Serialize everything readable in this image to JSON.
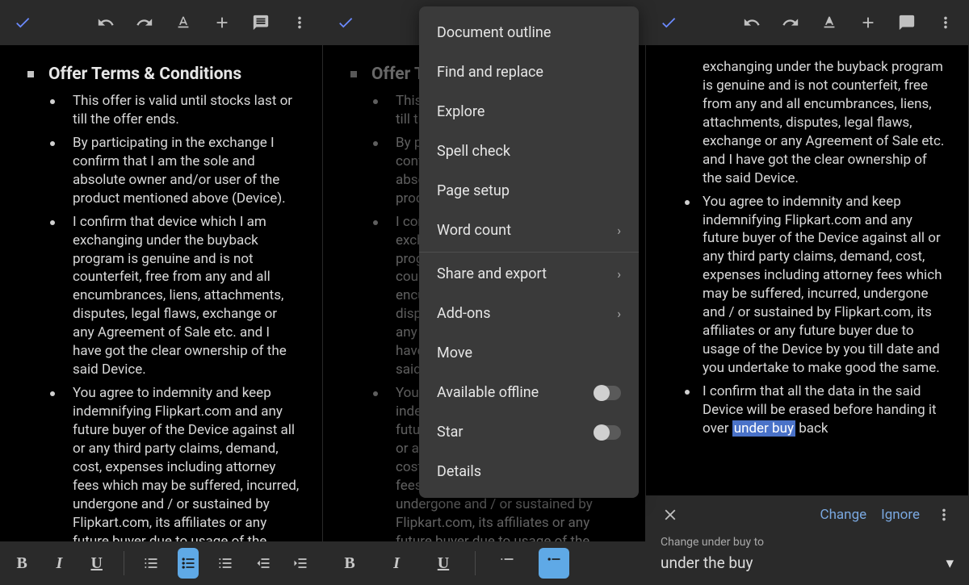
{
  "heading": "Offer Terms & Conditions",
  "bullets": [
    "This offer is valid until stocks last or till the offer ends.",
    "By participating in the exchange I confirm that I am the sole and absolute owner and/or user of the product mentioned above (Device).",
    "I confirm that device which I am exchanging under the buyback program is genuine and is not counterfeit, free from any and all encumbrances, liens, attachments, disputes, legal flaws, exchange or any Agreement of Sale etc. and I have got the clear ownership of the said Device.",
    "You agree to indemnity and keep indemnifying Flipkart.com and any future buyer of the Device against all or any third party claims, demand, cost, expenses including attorney fees which may be suffered, incurred, undergone and / or sustained by Flipkart.com, its affiliates or any future buyer due to usage of the Device by you till date"
  ],
  "menu": {
    "outline": "Document outline",
    "find": "Find and replace",
    "explore": "Explore",
    "spell": "Spell check",
    "page": "Page setup",
    "word": "Word count",
    "share": "Share and export",
    "addons": "Add-ons",
    "move": "Move",
    "offline": "Available offline",
    "star": "Star",
    "details": "Details"
  },
  "panel3": {
    "lead": "exchanging under the buyback program is genuine and is not counterfeit, free from any and all encumbrances, liens, attachments, disputes, legal flaws, exchange or any Agreement of Sale etc. and I have got the clear ownership of the said Device.",
    "b2": "You agree to indemnity and keep indemnifying Flipkart.com and any future buyer of the Device against all or any third party claims, demand, cost, expenses including attorney fees which may be suffered, incurred, undergone and / or sustained by Flipkart.com, its affiliates or any future buyer due to usage of the Device by you till date and you undertake to make good the same.",
    "b3_pre": "I confirm that all the data in the said Device will be erased before handing it over ",
    "b3_hl": "under buy",
    "b3_post": " back"
  },
  "spell": {
    "change": "Change",
    "ignore": "Ignore",
    "label": "Change under buy to",
    "suggestion": "under the buy"
  }
}
